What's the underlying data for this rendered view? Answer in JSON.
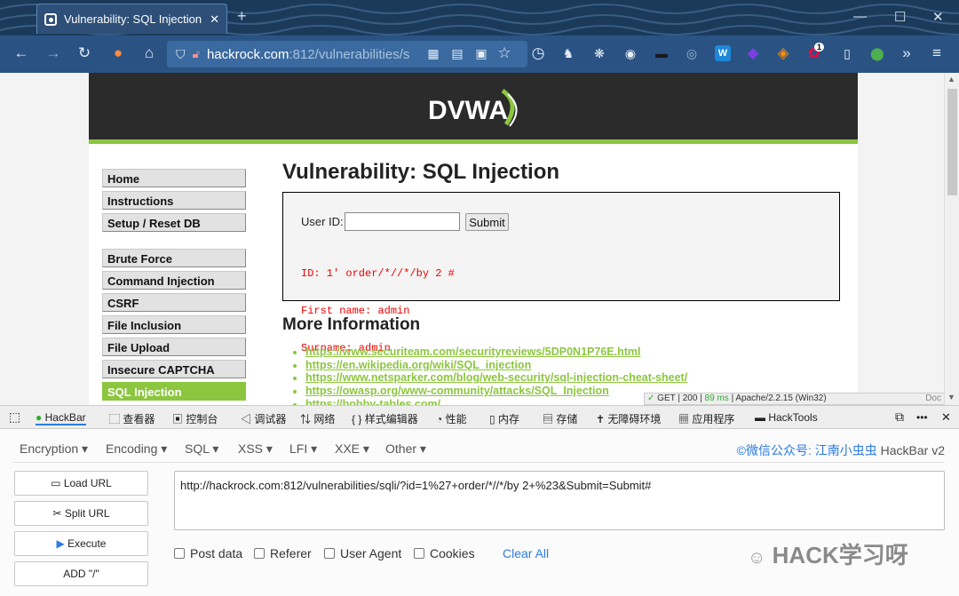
{
  "browser": {
    "tab_title": "Vulnerability: SQL Injection ::",
    "url_host": "hackrock.com",
    "url_path": ":812/vulnerabilities/s",
    "ext_badge_count": "1",
    "ext_w_label": "W"
  },
  "page": {
    "title": "Vulnerability: SQL Injection",
    "logo_text": "DVWA",
    "menu_group1": [
      "Home",
      "Instructions",
      "Setup / Reset DB"
    ],
    "menu_group2": [
      "Brute Force",
      "Command Injection",
      "CSRF",
      "File Inclusion",
      "File Upload",
      "Insecure CAPTCHA",
      "SQL Injection"
    ],
    "userid_label": "User ID:",
    "userid_value": "",
    "submit_label": "Submit",
    "result_lines": [
      "ID: 1' order/*//*/by 2 #",
      "First name: admin",
      "Surname: admin"
    ],
    "more_info_title": "More Information",
    "links": [
      "https://www.securiteam.com/securityreviews/5DP0N1P76E.html",
      "https://en.wikipedia.org/wiki/SQL_injection",
      "https://www.netsparker.com/blog/web-security/sql-injection-cheat-sheet/",
      "https://owasp.org/www-community/attacks/SQL_Injection",
      "https://bobby-tables.com/"
    ],
    "status_check": "✓",
    "status_text": "GET | 200 |",
    "status_ms": "89 ms",
    "status_server": "| Apache/2.2.15 (Win32)",
    "status_doc": "Doc"
  },
  "devtools": {
    "tabs": [
      "HackBar",
      "查看器",
      "控制台",
      "调试器",
      "网络",
      "样式编辑器",
      "性能",
      "内存",
      "存储",
      "无障碍环境",
      "应用程序",
      "HackTools"
    ],
    "more": "•••"
  },
  "hackbar": {
    "menus": [
      "Encryption",
      "Encoding",
      "SQL",
      "XSS",
      "LFI",
      "XXE",
      "Other"
    ],
    "brand_prefix": "©微信公众号: ",
    "brand_name": "江南小虫虫",
    "brand_suffix": " HackBar v2",
    "buttons": [
      "Load URL",
      "Split URL",
      "Execute",
      "ADD \"/\""
    ],
    "url_value": "http://hackrock.com:812/vulnerabilities/sqli/?id=1%27+order/*//*/by 2+%23&Submit=Submit#",
    "options": [
      "Post data",
      "Referer",
      "User Agent",
      "Cookies"
    ],
    "clear_all": "Clear All",
    "watermark": "HACK学习呀"
  },
  "colors": {
    "dvwa_green": "#8cc63f",
    "link_blue": "#2a7be4",
    "result_red": "#ee0000"
  }
}
